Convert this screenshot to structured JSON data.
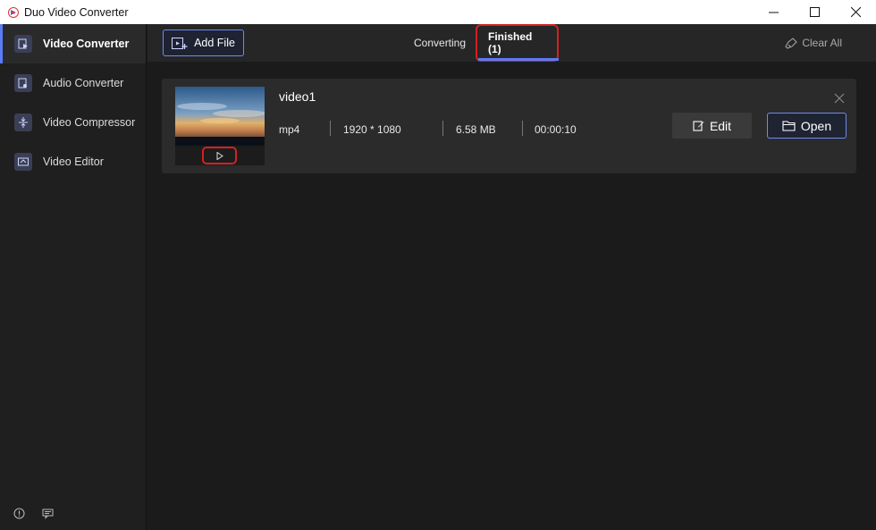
{
  "window": {
    "title": "Duo Video Converter",
    "controls": [
      "minimize-icon",
      "maximize-icon",
      "close-icon"
    ]
  },
  "sidebar": {
    "items": [
      {
        "label": "Video Converter",
        "icon": "video-convert-icon",
        "active": true
      },
      {
        "label": "Audio Converter",
        "icon": "audio-convert-icon",
        "active": false
      },
      {
        "label": "Video Compressor",
        "icon": "compress-icon",
        "active": false
      },
      {
        "label": "Video Editor",
        "icon": "video-edit-icon",
        "active": false
      }
    ],
    "footer_icons": [
      "info-icon",
      "feedback-icon"
    ]
  },
  "toolbar": {
    "add_file_label": "Add File",
    "tabs": [
      {
        "label": "Converting",
        "active": false
      },
      {
        "label": "Finished (1)",
        "active": true
      }
    ],
    "clear_all_label": "Clear All"
  },
  "files": [
    {
      "name": "video1",
      "format": "mp4",
      "resolution": "1920 * 1080",
      "size": "6.58 MB",
      "duration": "00:00:10",
      "edit_label": "Edit",
      "open_label": "Open"
    }
  ],
  "colors": {
    "accent": "#5a7cf5",
    "highlight": "#d42020",
    "background": "#1b1b1b",
    "card": "#2b2b2b"
  }
}
